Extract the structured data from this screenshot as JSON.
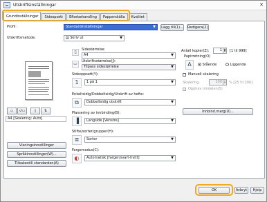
{
  "window": {
    "title": "Utskriftsinställningar",
    "close_glyph": "✕"
  },
  "tabs": [
    {
      "label": "Grundinställningar"
    },
    {
      "label": "Sidoopsett"
    },
    {
      "label": "Efterbehandling"
    },
    {
      "label": "Papperskälla"
    },
    {
      "label": "Kvalitet"
    }
  ],
  "profile": {
    "label": "Profil :",
    "value": "Standardinställningar",
    "add_button": "Lägg till(1)...",
    "edit_button": "Redigera(2)..."
  },
  "output_method": {
    "label": "Utskriftsmetode:",
    "value": "Skriv ut"
  },
  "preview": {
    "status": "A4 [Skalering: Auto]",
    "view_buttons": [
      "▭",
      "↺▭",
      "▯",
      "⇅"
    ]
  },
  "page_size": {
    "label": "Sidestørrelse:",
    "value": "A4"
  },
  "output_size": {
    "label": "Utskriftsstørrelse(J):",
    "value": "Tilpass sidestørrelse"
  },
  "copies": {
    "label": "Antall kopier(Z):",
    "value": "1",
    "range": "[1 til 999]"
  },
  "orientation": {
    "label": "Papirretning(O)",
    "portrait": "Stående",
    "landscape": "Liggende"
  },
  "page_layout": {
    "label": "Sideoppsett(Y):",
    "value": "1 på 1"
  },
  "manual_scaling": {
    "label": "Manuell skalering"
  },
  "scaling": {
    "label": "Skalering:",
    "value": "100",
    "range": "% [25 til 200]"
  },
  "booklet": {
    "label": "Opphev inndelen(5)"
  },
  "duplex": {
    "label": "Enkeltsidig/Dobbeltsidig/Utskrift av hefte:",
    "value": "Dobbeltsidig utskrift"
  },
  "binding_location": {
    "label": "Plassering av innbinding(B):",
    "value": "Langside [Venstre]",
    "margin_button": "Innbind.marg(U)..."
  },
  "stapler": {
    "label": "Stifte/sorter/grupper(H):",
    "value": "Sorter"
  },
  "color_mode": {
    "label": "Fargemodus(C):",
    "value": "Automatisk [farger/svart-hvitt]"
  },
  "left_buttons": {
    "printer_settings": "Visningsinnstillinger",
    "language": "Språkinnstillinger(W)...",
    "restore_defaults": "Tilbakestill standarden(A)"
  },
  "footer": {
    "ok": "OK",
    "cancel": "Avbryt",
    "help": "Hjelp"
  },
  "colors": {
    "highlight": "#f0a81c",
    "selection": "#3c6fd5"
  }
}
